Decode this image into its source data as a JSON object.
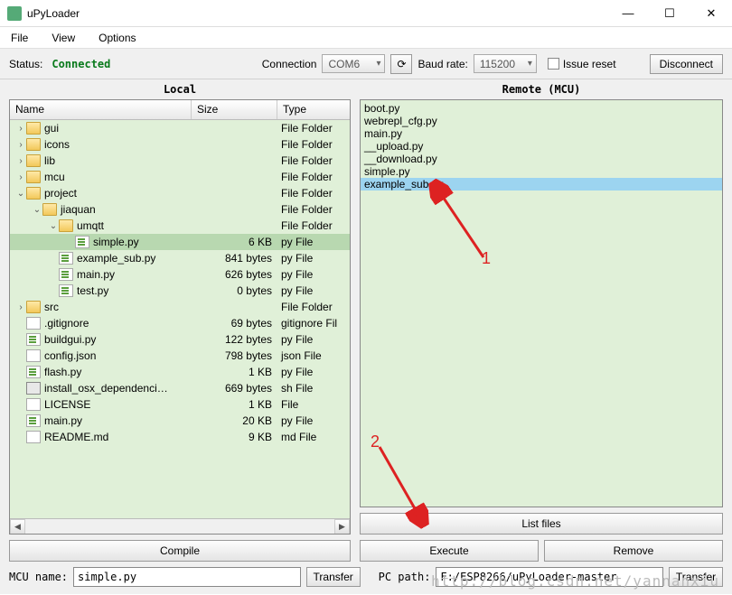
{
  "window": {
    "title": "uPyLoader",
    "min_icon": "—",
    "max_icon": "☐",
    "close_icon": "✕"
  },
  "menu": {
    "file": "File",
    "view": "View",
    "options": "Options"
  },
  "toolbar": {
    "status_label": "Status:",
    "status_value": "Connected",
    "connection_label": "Connection",
    "connection_value": "COM6",
    "baud_label": "Baud rate:",
    "baud_value": "115200",
    "issue_reset_label": "Issue reset",
    "disconnect": "Disconnect",
    "refresh_icon": "⟳"
  },
  "panels": {
    "local_title": "Local",
    "remote_title": "Remote (MCU)"
  },
  "headers": {
    "name": "Name",
    "size": "Size",
    "type": "Type"
  },
  "local_tree": [
    {
      "indent": 0,
      "arrow": ">",
      "icon": "folder",
      "name": "gui",
      "size": "",
      "type": "File Folder"
    },
    {
      "indent": 0,
      "arrow": ">",
      "icon": "folder",
      "name": "icons",
      "size": "",
      "type": "File Folder"
    },
    {
      "indent": 0,
      "arrow": ">",
      "icon": "folder",
      "name": "lib",
      "size": "",
      "type": "File Folder"
    },
    {
      "indent": 0,
      "arrow": ">",
      "icon": "folder",
      "name": "mcu",
      "size": "",
      "type": "File Folder"
    },
    {
      "indent": 0,
      "arrow": "v",
      "icon": "folder",
      "name": "project",
      "size": "",
      "type": "File Folder"
    },
    {
      "indent": 1,
      "arrow": "v",
      "icon": "folder",
      "name": "jiaquan",
      "size": "",
      "type": "File Folder"
    },
    {
      "indent": 2,
      "arrow": "v",
      "icon": "folder",
      "name": "umqtt",
      "size": "",
      "type": "File Folder"
    },
    {
      "indent": 3,
      "arrow": "",
      "icon": "pyfile",
      "name": "simple.py",
      "size": "6 KB",
      "type": "py File",
      "selected": true
    },
    {
      "indent": 2,
      "arrow": "",
      "icon": "pyfile",
      "name": "example_sub.py",
      "size": "841 bytes",
      "type": "py File"
    },
    {
      "indent": 2,
      "arrow": "",
      "icon": "pyfile",
      "name": "main.py",
      "size": "626 bytes",
      "type": "py File"
    },
    {
      "indent": 2,
      "arrow": "",
      "icon": "pyfile",
      "name": "test.py",
      "size": "0 bytes",
      "type": "py File"
    },
    {
      "indent": 0,
      "arrow": ">",
      "icon": "folder",
      "name": "src",
      "size": "",
      "type": "File Folder"
    },
    {
      "indent": 0,
      "arrow": "",
      "icon": "txtfile",
      "name": ".gitignore",
      "size": "69 bytes",
      "type": "gitignore Fil"
    },
    {
      "indent": 0,
      "arrow": "",
      "icon": "pyfile",
      "name": "buildgui.py",
      "size": "122 bytes",
      "type": "py File"
    },
    {
      "indent": 0,
      "arrow": "",
      "icon": "txtfile",
      "name": "config.json",
      "size": "798 bytes",
      "type": "json File"
    },
    {
      "indent": 0,
      "arrow": "",
      "icon": "pyfile",
      "name": "flash.py",
      "size": "1 KB",
      "type": "py File"
    },
    {
      "indent": 0,
      "arrow": "",
      "icon": "shfile",
      "name": "install_osx_dependenci…",
      "size": "669 bytes",
      "type": "sh File"
    },
    {
      "indent": 0,
      "arrow": "",
      "icon": "txtfile",
      "name": "LICENSE",
      "size": "1 KB",
      "type": "File"
    },
    {
      "indent": 0,
      "arrow": "",
      "icon": "pyfile",
      "name": "main.py",
      "size": "20 KB",
      "type": "py File"
    },
    {
      "indent": 0,
      "arrow": "",
      "icon": "txtfile",
      "name": "README.md",
      "size": "9 KB",
      "type": "md File"
    }
  ],
  "remote_list": [
    {
      "name": "boot.py"
    },
    {
      "name": "webrepl_cfg.py"
    },
    {
      "name": "main.py"
    },
    {
      "name": "__upload.py"
    },
    {
      "name": "__download.py"
    },
    {
      "name": "simple.py"
    },
    {
      "name": "example_sub.py",
      "selected": true
    }
  ],
  "buttons": {
    "compile": "Compile",
    "list_files": "List files",
    "execute": "Execute",
    "remove": "Remove",
    "transfer_local": "Transfer",
    "transfer_remote": "Transfer"
  },
  "bottom": {
    "mcu_name_label": "MCU name:",
    "mcu_name_value": "simple.py",
    "pc_path_label": "PC path:",
    "pc_path_value": "F:/ESP8266/uPyLoader-master"
  },
  "annotations": {
    "label1": "1",
    "label2": "2"
  },
  "watermark": "http://blog.csdn.net/yannanxiu"
}
